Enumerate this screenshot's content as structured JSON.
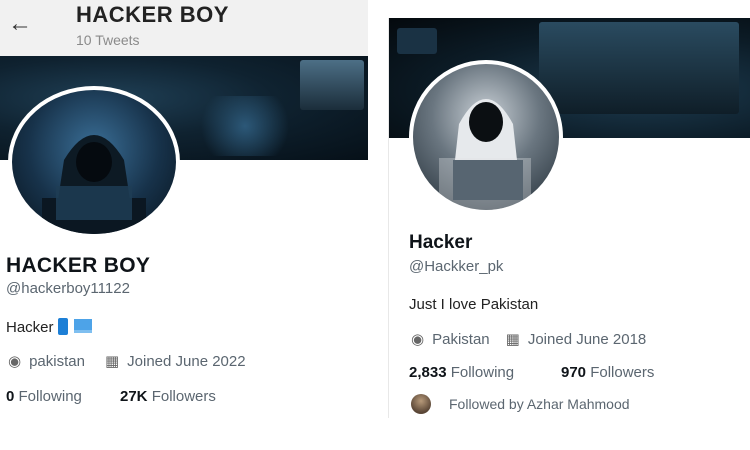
{
  "left_profile": {
    "header_title": "HACKER BOY",
    "tweets_count": "10 Tweets",
    "display_name": "HACKER BOY",
    "handle": "@hackerboy11122",
    "bio": "Hacker",
    "location": "pakistan",
    "joined": "Joined June 2022",
    "following_count": "0",
    "following_label": "Following",
    "followers_count": "27K",
    "followers_label": "Followers"
  },
  "right_profile": {
    "display_name": "Hacker",
    "handle": "@Hackker_pk",
    "bio": "Just I love Pakistan",
    "location": "Pakistan",
    "joined": "Joined June 2018",
    "following_count": "2,833",
    "following_label": "Following",
    "followers_count": "970",
    "followers_label": "Followers",
    "followed_by": "Followed by Azhar Mahmood"
  },
  "icons": {
    "back": "back-arrow-icon",
    "location": "location-pin-icon",
    "calendar": "calendar-icon",
    "bio_emoji_1": "mobile-phone-icon",
    "bio_emoji_2": "laptop-icon"
  }
}
